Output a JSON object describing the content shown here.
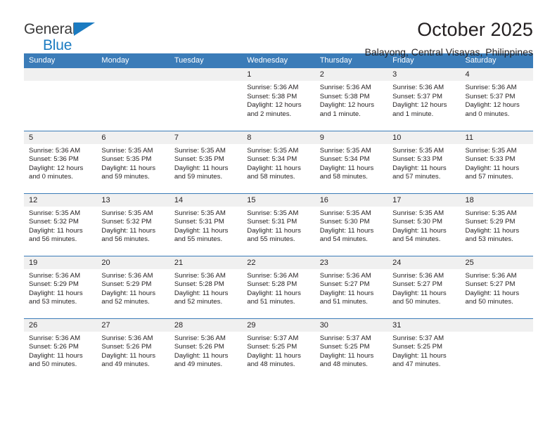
{
  "brand": {
    "line1": "General",
    "line2": "Blue",
    "triangle_color": "#1b7bc1",
    "line1_color": "#3b3b3b",
    "line2_color": "#1b7bc1"
  },
  "header": {
    "month_title": "October 2025",
    "location": "Balayong, Central Visayas, Philippines"
  },
  "theme": {
    "header_blue": "#3b7cb8",
    "day_band_gray": "#f0f0f0",
    "text": "#231f20"
  },
  "weekdays": [
    "Sunday",
    "Monday",
    "Tuesday",
    "Wednesday",
    "Thursday",
    "Friday",
    "Saturday"
  ],
  "labels": {
    "sunrise_prefix": "Sunrise:",
    "sunset_prefix": "Sunset:",
    "daylight_prefix": "Daylight:"
  },
  "weeks": [
    [
      {
        "empty": true
      },
      {
        "empty": true
      },
      {
        "empty": true
      },
      {
        "day": "1",
        "sunrise": "Sunrise: 5:36 AM",
        "sunset": "Sunset: 5:38 PM",
        "daylight1": "Daylight: 12 hours",
        "daylight2": "and 2 minutes."
      },
      {
        "day": "2",
        "sunrise": "Sunrise: 5:36 AM",
        "sunset": "Sunset: 5:38 PM",
        "daylight1": "Daylight: 12 hours",
        "daylight2": "and 1 minute."
      },
      {
        "day": "3",
        "sunrise": "Sunrise: 5:36 AM",
        "sunset": "Sunset: 5:37 PM",
        "daylight1": "Daylight: 12 hours",
        "daylight2": "and 1 minute."
      },
      {
        "day": "4",
        "sunrise": "Sunrise: 5:36 AM",
        "sunset": "Sunset: 5:37 PM",
        "daylight1": "Daylight: 12 hours",
        "daylight2": "and 0 minutes."
      }
    ],
    [
      {
        "day": "5",
        "sunrise": "Sunrise: 5:36 AM",
        "sunset": "Sunset: 5:36 PM",
        "daylight1": "Daylight: 12 hours",
        "daylight2": "and 0 minutes."
      },
      {
        "day": "6",
        "sunrise": "Sunrise: 5:35 AM",
        "sunset": "Sunset: 5:35 PM",
        "daylight1": "Daylight: 11 hours",
        "daylight2": "and 59 minutes."
      },
      {
        "day": "7",
        "sunrise": "Sunrise: 5:35 AM",
        "sunset": "Sunset: 5:35 PM",
        "daylight1": "Daylight: 11 hours",
        "daylight2": "and 59 minutes."
      },
      {
        "day": "8",
        "sunrise": "Sunrise: 5:35 AM",
        "sunset": "Sunset: 5:34 PM",
        "daylight1": "Daylight: 11 hours",
        "daylight2": "and 58 minutes."
      },
      {
        "day": "9",
        "sunrise": "Sunrise: 5:35 AM",
        "sunset": "Sunset: 5:34 PM",
        "daylight1": "Daylight: 11 hours",
        "daylight2": "and 58 minutes."
      },
      {
        "day": "10",
        "sunrise": "Sunrise: 5:35 AM",
        "sunset": "Sunset: 5:33 PM",
        "daylight1": "Daylight: 11 hours",
        "daylight2": "and 57 minutes."
      },
      {
        "day": "11",
        "sunrise": "Sunrise: 5:35 AM",
        "sunset": "Sunset: 5:33 PM",
        "daylight1": "Daylight: 11 hours",
        "daylight2": "and 57 minutes."
      }
    ],
    [
      {
        "day": "12",
        "sunrise": "Sunrise: 5:35 AM",
        "sunset": "Sunset: 5:32 PM",
        "daylight1": "Daylight: 11 hours",
        "daylight2": "and 56 minutes."
      },
      {
        "day": "13",
        "sunrise": "Sunrise: 5:35 AM",
        "sunset": "Sunset: 5:32 PM",
        "daylight1": "Daylight: 11 hours",
        "daylight2": "and 56 minutes."
      },
      {
        "day": "14",
        "sunrise": "Sunrise: 5:35 AM",
        "sunset": "Sunset: 5:31 PM",
        "daylight1": "Daylight: 11 hours",
        "daylight2": "and 55 minutes."
      },
      {
        "day": "15",
        "sunrise": "Sunrise: 5:35 AM",
        "sunset": "Sunset: 5:31 PM",
        "daylight1": "Daylight: 11 hours",
        "daylight2": "and 55 minutes."
      },
      {
        "day": "16",
        "sunrise": "Sunrise: 5:35 AM",
        "sunset": "Sunset: 5:30 PM",
        "daylight1": "Daylight: 11 hours",
        "daylight2": "and 54 minutes."
      },
      {
        "day": "17",
        "sunrise": "Sunrise: 5:35 AM",
        "sunset": "Sunset: 5:30 PM",
        "daylight1": "Daylight: 11 hours",
        "daylight2": "and 54 minutes."
      },
      {
        "day": "18",
        "sunrise": "Sunrise: 5:35 AM",
        "sunset": "Sunset: 5:29 PM",
        "daylight1": "Daylight: 11 hours",
        "daylight2": "and 53 minutes."
      }
    ],
    [
      {
        "day": "19",
        "sunrise": "Sunrise: 5:36 AM",
        "sunset": "Sunset: 5:29 PM",
        "daylight1": "Daylight: 11 hours",
        "daylight2": "and 53 minutes."
      },
      {
        "day": "20",
        "sunrise": "Sunrise: 5:36 AM",
        "sunset": "Sunset: 5:29 PM",
        "daylight1": "Daylight: 11 hours",
        "daylight2": "and 52 minutes."
      },
      {
        "day": "21",
        "sunrise": "Sunrise: 5:36 AM",
        "sunset": "Sunset: 5:28 PM",
        "daylight1": "Daylight: 11 hours",
        "daylight2": "and 52 minutes."
      },
      {
        "day": "22",
        "sunrise": "Sunrise: 5:36 AM",
        "sunset": "Sunset: 5:28 PM",
        "daylight1": "Daylight: 11 hours",
        "daylight2": "and 51 minutes."
      },
      {
        "day": "23",
        "sunrise": "Sunrise: 5:36 AM",
        "sunset": "Sunset: 5:27 PM",
        "daylight1": "Daylight: 11 hours",
        "daylight2": "and 51 minutes."
      },
      {
        "day": "24",
        "sunrise": "Sunrise: 5:36 AM",
        "sunset": "Sunset: 5:27 PM",
        "daylight1": "Daylight: 11 hours",
        "daylight2": "and 50 minutes."
      },
      {
        "day": "25",
        "sunrise": "Sunrise: 5:36 AM",
        "sunset": "Sunset: 5:27 PM",
        "daylight1": "Daylight: 11 hours",
        "daylight2": "and 50 minutes."
      }
    ],
    [
      {
        "day": "26",
        "sunrise": "Sunrise: 5:36 AM",
        "sunset": "Sunset: 5:26 PM",
        "daylight1": "Daylight: 11 hours",
        "daylight2": "and 50 minutes."
      },
      {
        "day": "27",
        "sunrise": "Sunrise: 5:36 AM",
        "sunset": "Sunset: 5:26 PM",
        "daylight1": "Daylight: 11 hours",
        "daylight2": "and 49 minutes."
      },
      {
        "day": "28",
        "sunrise": "Sunrise: 5:36 AM",
        "sunset": "Sunset: 5:26 PM",
        "daylight1": "Daylight: 11 hours",
        "daylight2": "and 49 minutes."
      },
      {
        "day": "29",
        "sunrise": "Sunrise: 5:37 AM",
        "sunset": "Sunset: 5:25 PM",
        "daylight1": "Daylight: 11 hours",
        "daylight2": "and 48 minutes."
      },
      {
        "day": "30",
        "sunrise": "Sunrise: 5:37 AM",
        "sunset": "Sunset: 5:25 PM",
        "daylight1": "Daylight: 11 hours",
        "daylight2": "and 48 minutes."
      },
      {
        "day": "31",
        "sunrise": "Sunrise: 5:37 AM",
        "sunset": "Sunset: 5:25 PM",
        "daylight1": "Daylight: 11 hours",
        "daylight2": "and 47 minutes."
      },
      {
        "empty": true
      }
    ]
  ]
}
